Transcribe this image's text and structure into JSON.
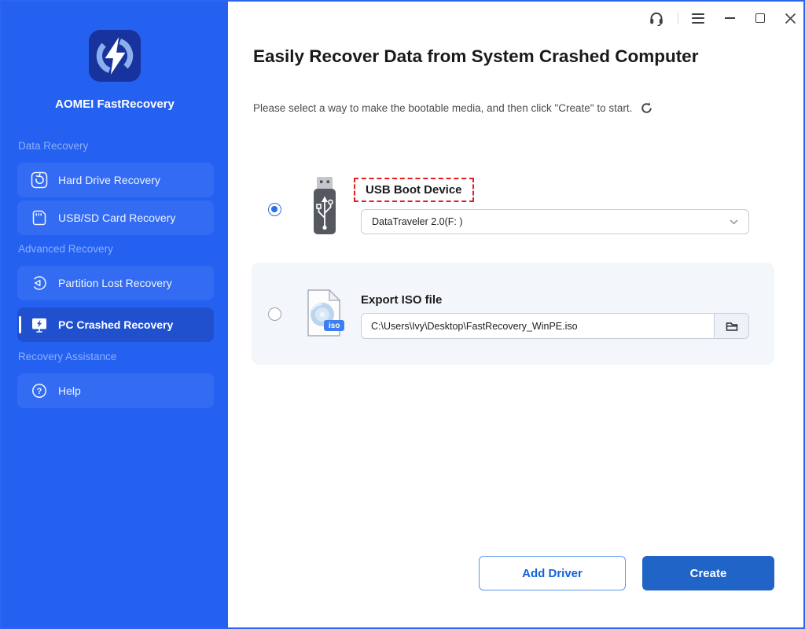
{
  "app": {
    "name": "AOMEI FastRecovery"
  },
  "sidebar": {
    "sections": [
      {
        "label": "Data Recovery",
        "items": [
          {
            "label": "Hard Drive Recovery"
          },
          {
            "label": "USB/SD Card Recovery"
          }
        ]
      },
      {
        "label": "Advanced Recovery",
        "items": [
          {
            "label": "Partition Lost Recovery"
          },
          {
            "label": "PC Crashed Recovery",
            "selected": true
          }
        ]
      },
      {
        "label": "Recovery Assistance",
        "items": [
          {
            "label": "Help"
          }
        ]
      }
    ]
  },
  "titlebar": {
    "icons": [
      "headset",
      "hamburger-menu",
      "minimize",
      "maximize",
      "close"
    ]
  },
  "main": {
    "title": "Easily Recover Data from System Crashed Computer",
    "subtitle": "Please select a way to make the bootable media, and then click \"Create\" to start.",
    "usb_option": {
      "label": "USB Boot Device",
      "device": "DataTraveler 2.0(F: )",
      "selected": true
    },
    "iso_option": {
      "label": "Export ISO file",
      "path": "C:\\Users\\Ivy\\Desktop\\FastRecovery_WinPE.iso",
      "badge": "iso",
      "selected": false
    },
    "buttons": {
      "add_driver": "Add Driver",
      "create": "Create"
    }
  },
  "colors": {
    "sidebar_blue": "#2461f1",
    "selected_item_blue": "#2150cf",
    "logo_bg": "#19339e",
    "annotation_red": "#e41e1e",
    "create_button_blue": "#2164c7",
    "link_blue": "#1361d8",
    "panel_gray": "#f3f6fa"
  }
}
